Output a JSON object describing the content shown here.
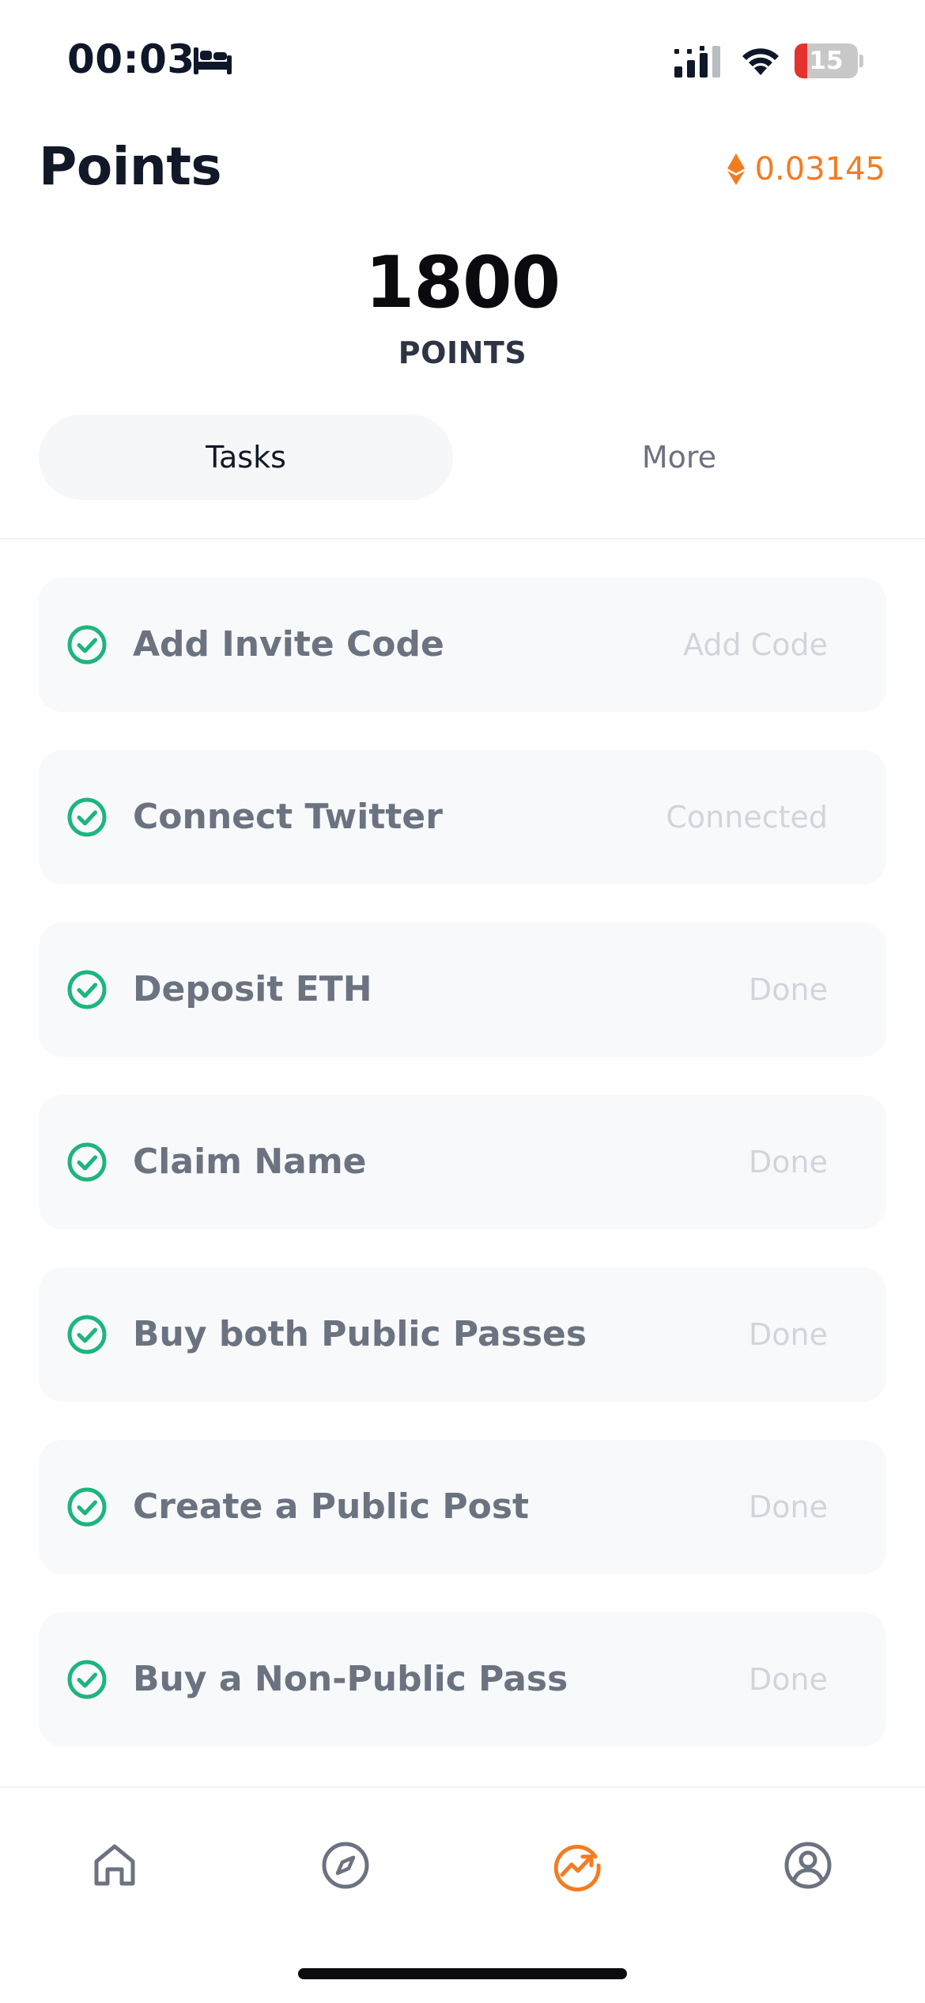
{
  "status_bar": {
    "time": "00:03",
    "battery_level": "15",
    "icons": [
      "sleep-icon",
      "signal-icon",
      "wifi-icon",
      "battery-icon"
    ]
  },
  "header": {
    "title": "Points",
    "eth_balance": "0.03145",
    "eth_icon": "ethereum-icon",
    "accent_color": "#f47c20"
  },
  "points": {
    "value": "1800",
    "label": "POINTS"
  },
  "tabs": [
    {
      "label": "Tasks",
      "selected": true
    },
    {
      "label": "More",
      "selected": false
    }
  ],
  "tasks": [
    {
      "label": "Add Invite Code",
      "action": "Add Code",
      "completed": true
    },
    {
      "label": "Connect Twitter",
      "action": "Connected",
      "completed": true
    },
    {
      "label": "Deposit ETH",
      "action": "Done",
      "completed": true
    },
    {
      "label": "Claim Name",
      "action": "Done",
      "completed": true
    },
    {
      "label": "Buy both Public Passes",
      "action": "Done",
      "completed": true
    },
    {
      "label": "Create a Public Post",
      "action": "Done",
      "completed": true
    },
    {
      "label": "Buy a Non-Public Pass",
      "action": "Done",
      "completed": true
    }
  ],
  "task_check_color": "#1db57e",
  "bottom_nav": {
    "items": [
      {
        "icon": "home-icon",
        "active": false
      },
      {
        "icon": "compass-icon",
        "active": false
      },
      {
        "icon": "trending-icon",
        "active": true
      },
      {
        "icon": "profile-icon",
        "active": false
      }
    ],
    "active_color": "#f47c20",
    "inactive_color": "#6b7280"
  }
}
